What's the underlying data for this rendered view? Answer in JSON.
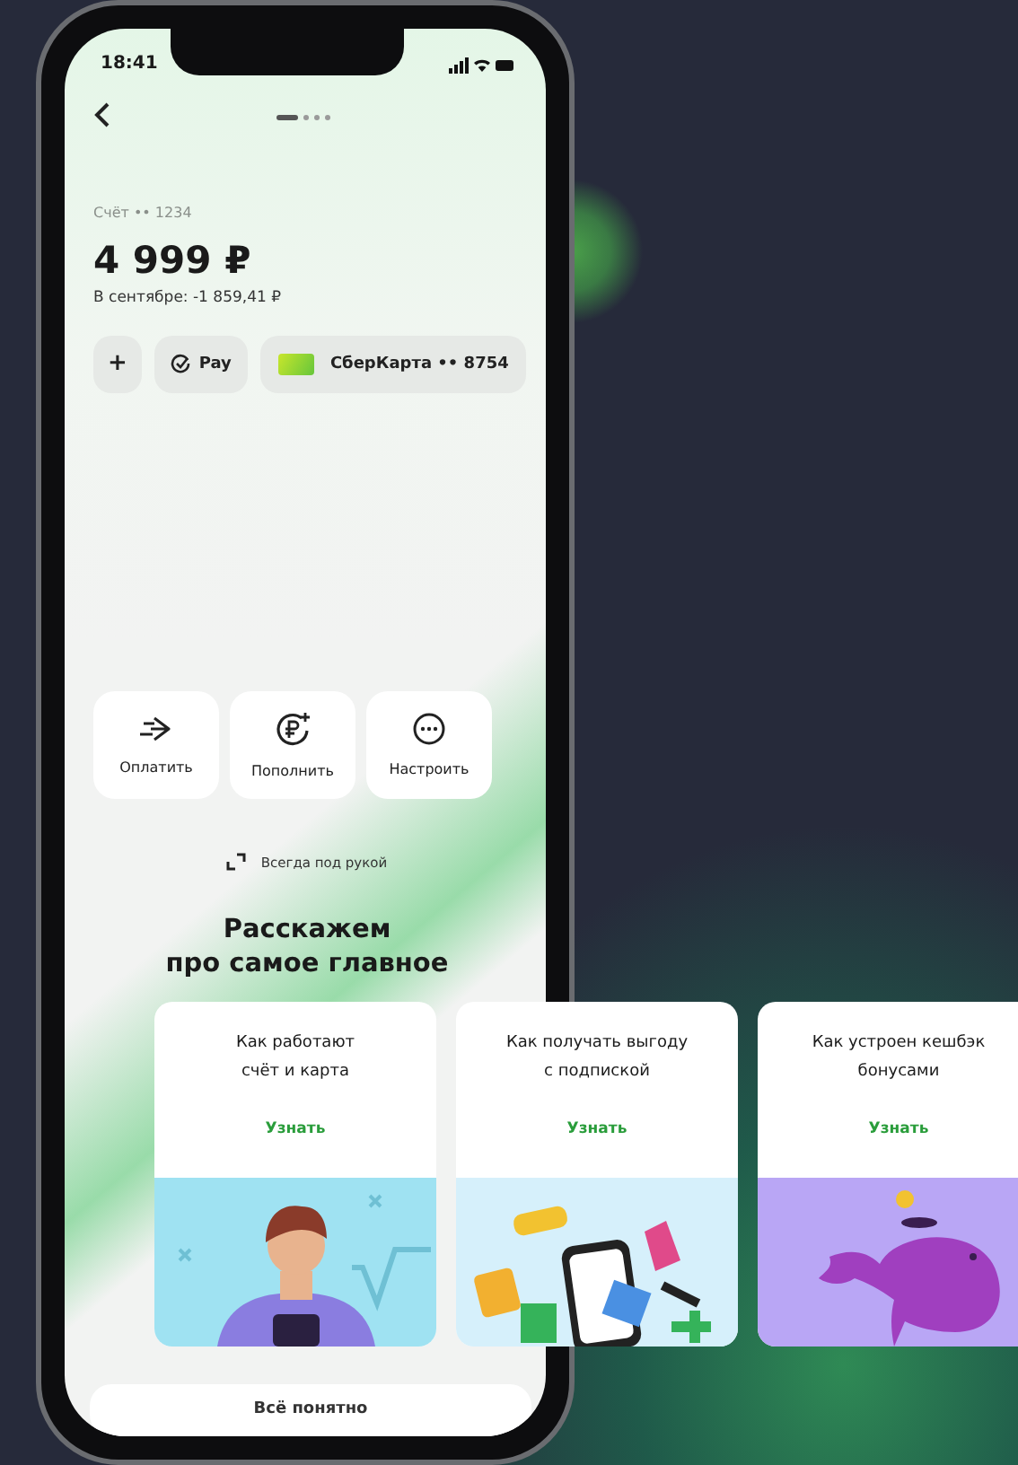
{
  "status_bar": {
    "time": "18:41"
  },
  "pager": [
    {
      "selected": true
    },
    {
      "selected": false
    },
    {
      "selected": false
    },
    {
      "selected": false
    }
  ],
  "account": {
    "label": "Счёт •• 1234",
    "balance": "4 999 ₽",
    "month_change": "В сентябре: -1 859,41 ₽"
  },
  "chips": [
    {
      "kind": "add",
      "label": "+"
    },
    {
      "kind": "pay",
      "label": "Pay"
    },
    {
      "kind": "card",
      "label": "СберКарта •• 8754"
    }
  ],
  "actions": [
    {
      "kind": "pay",
      "label": "Оплатить"
    },
    {
      "kind": "topup",
      "label": "Пополнить"
    },
    {
      "kind": "more",
      "label": "Настроить"
    }
  ],
  "pin_hint": "Всегда под рукой",
  "section_title_lines": [
    "Расскажем",
    "про самое главное"
  ],
  "cards": [
    {
      "kind": "person",
      "title_lines": [
        "Как работают",
        "счёт и карта"
      ],
      "link": "Узнать"
    },
    {
      "kind": "subscription",
      "title_lines": [
        "Как получать выгоду",
        "с подпиской"
      ],
      "link": "Узнать"
    },
    {
      "kind": "whale",
      "title_lines": [
        "Как устроен кешбэк",
        "бонусами"
      ],
      "link": "Узнать"
    }
  ],
  "confirm_button": "Всё понятно"
}
